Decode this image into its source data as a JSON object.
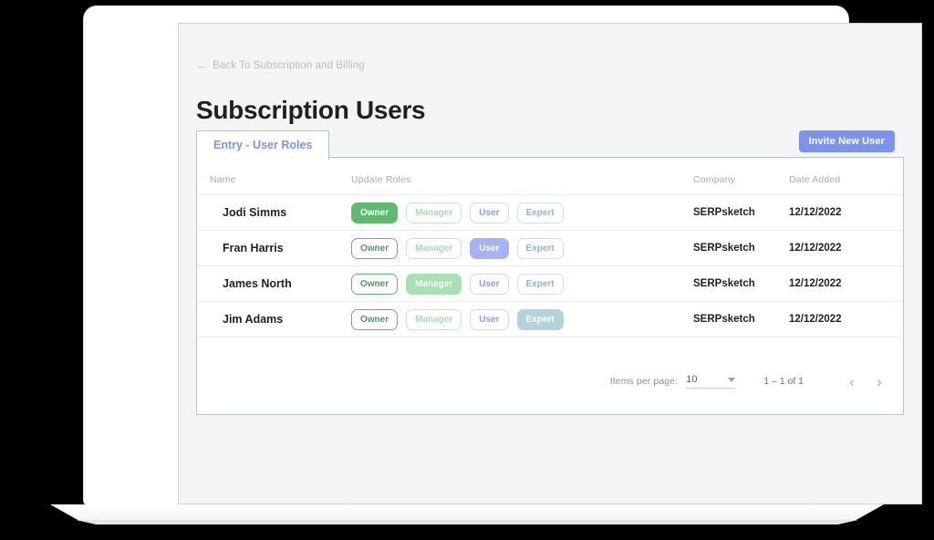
{
  "back_link": {
    "label": "Back To Subscription and Billing",
    "icon": "arrow-left-icon",
    "glyph": "←"
  },
  "page_title": "Subscription Users",
  "tabs": [
    {
      "label": "Entry - User Roles",
      "active": true
    }
  ],
  "actions": {
    "invite_new_user": "Invite New User"
  },
  "table": {
    "columns": [
      "Name",
      "Update Roles",
      "Company",
      "Date Added"
    ],
    "role_labels": [
      "Owner",
      "Manager",
      "User",
      "Expert"
    ],
    "rows": [
      {
        "name": "Jodi Simms",
        "roles": [
          {
            "label": "Owner",
            "active": true,
            "style": "role-owner-on"
          },
          {
            "label": "Manager",
            "active": false,
            "style": "role-manager-off"
          },
          {
            "label": "User",
            "active": false,
            "style": "role-user-off"
          },
          {
            "label": "Expert",
            "active": false,
            "style": "role-expert-off"
          }
        ],
        "company": "SERPsketch",
        "date_added": "12/12/2022"
      },
      {
        "name": "Fran Harris",
        "roles": [
          {
            "label": "Owner",
            "active": false,
            "style": "role-owner-off"
          },
          {
            "label": "Manager",
            "active": false,
            "style": "role-manager-off"
          },
          {
            "label": "User",
            "active": true,
            "style": "role-user-on"
          },
          {
            "label": "Expert",
            "active": false,
            "style": "role-expert-off"
          }
        ],
        "company": "SERPsketch",
        "date_added": "12/12/2022"
      },
      {
        "name": "James North",
        "roles": [
          {
            "label": "Owner",
            "active": false,
            "style": "role-owner-off"
          },
          {
            "label": "Manager",
            "active": true,
            "style": "role-manager-on"
          },
          {
            "label": "User",
            "active": false,
            "style": "role-user-off"
          },
          {
            "label": "Expert",
            "active": false,
            "style": "role-expert-off"
          }
        ],
        "company": "SERPsketch",
        "date_added": "12/12/2022"
      },
      {
        "name": "Jim Adams",
        "roles": [
          {
            "label": "Owner",
            "active": false,
            "style": "role-owner-off"
          },
          {
            "label": "Manager",
            "active": false,
            "style": "role-manager-off"
          },
          {
            "label": "User",
            "active": false,
            "style": "role-user-off"
          },
          {
            "label": "Expert",
            "active": true,
            "style": "role-expert-on"
          }
        ],
        "company": "SERPsketch",
        "date_added": "12/12/2022"
      }
    ]
  },
  "paginator": {
    "items_per_page_label": "Items per page:",
    "page_size": "10",
    "page_size_options": [
      "10"
    ],
    "range_label": "1 – 1 of 1",
    "prev_icon": "chevron-left-icon",
    "prev_glyph": "‹",
    "next_icon": "chevron-right-icon",
    "next_glyph": "›"
  },
  "colors": {
    "accent_blue": "#7a94ee",
    "active_owner_green": "#5fba6f",
    "active_manager_green": "#a7e0b2",
    "active_user_blue": "#a3b3f5",
    "active_expert_blue": "#b4d2dc",
    "panel_border": "#b8c4c6",
    "page_background": "#f4f5f5",
    "backdrop": "#000000"
  }
}
